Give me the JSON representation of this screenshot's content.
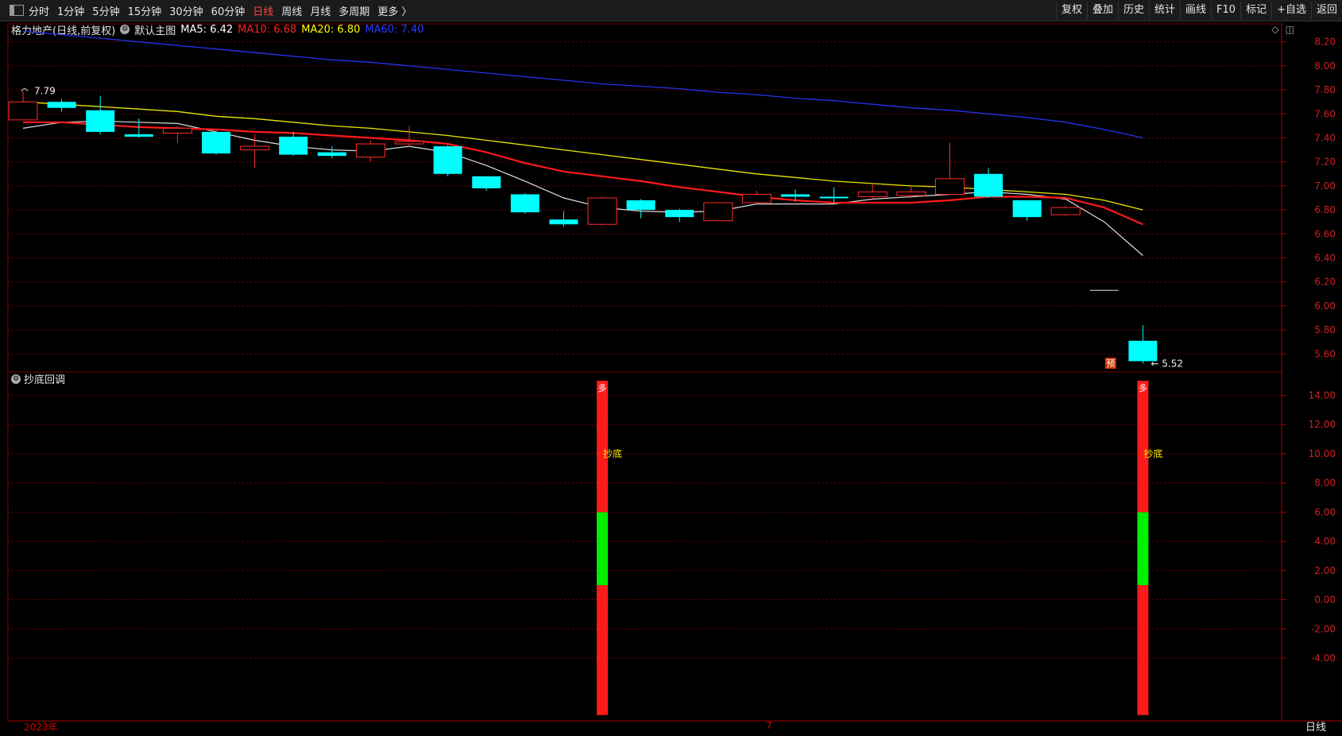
{
  "toolbar": {
    "periods": [
      "分时",
      "1分钟",
      "5分钟",
      "15分钟",
      "30分钟",
      "60分钟",
      "日线",
      "周线",
      "月线",
      "多周期",
      "更多 〉"
    ],
    "active_period": "日线",
    "right_tools": [
      "复权",
      "叠加",
      "历史",
      "统计",
      "画线",
      "F10",
      "标记",
      "+自选",
      "返回"
    ]
  },
  "main_panel": {
    "stock_title": "格力地产(日线,前复权)",
    "template": "默认主图",
    "ma": [
      {
        "label": "MA5: 6.42",
        "color": "#ffffff"
      },
      {
        "label": "MA10: 6.68",
        "color": "#ff2020"
      },
      {
        "label": "MA20: 6.80",
        "color": "#ffff00"
      },
      {
        "label": "MA60: 7.40",
        "color": "#2a3cff"
      }
    ],
    "high_label": "7.79",
    "low_label": "5.52",
    "forecast_badge": "预",
    "colors": {
      "up": "#ff2a2a",
      "down": "#00ffff",
      "ma5": "#dddddd",
      "ma10": "#ff1a1a",
      "ma20": "#e8e800",
      "ma60": "#2233ee",
      "grid": "#7a0000"
    }
  },
  "indicator_panel": {
    "title": "抄底回调",
    "signal_top_label": "多",
    "signal_mid_label": "抄底",
    "colors": {
      "red": "#ff1a1a",
      "green": "#00ee00",
      "label": "#ffee00"
    }
  },
  "footer": {
    "year": "2023年",
    "month": "7",
    "tab": "日线"
  },
  "chart_data": [
    {
      "type": "candlestick",
      "title": "格力地产(日线,前复权)",
      "ylim": [
        5.45,
        8.35
      ],
      "y_ticks": [
        8.2,
        8.0,
        7.8,
        7.6,
        7.4,
        7.2,
        7.0,
        6.8,
        6.6,
        6.4,
        6.2,
        6.0,
        5.8,
        5.6
      ],
      "candles": [
        {
          "o": 7.55,
          "c": 7.7,
          "h": 7.79,
          "l": 7.55
        },
        {
          "o": 7.7,
          "c": 7.65,
          "h": 7.72,
          "l": 7.62
        },
        {
          "o": 7.63,
          "c": 7.45,
          "h": 7.75,
          "l": 7.43
        },
        {
          "o": 7.43,
          "c": 7.41,
          "h": 7.56,
          "l": 7.4
        },
        {
          "o": 7.44,
          "c": 7.48,
          "h": 7.5,
          "l": 7.36
        },
        {
          "o": 7.45,
          "c": 7.27,
          "h": 7.46,
          "l": 7.26
        },
        {
          "o": 7.3,
          "c": 7.33,
          "h": 7.43,
          "l": 7.15
        },
        {
          "o": 7.41,
          "c": 7.26,
          "h": 7.45,
          "l": 7.25
        },
        {
          "o": 7.28,
          "c": 7.25,
          "h": 7.33,
          "l": 7.23
        },
        {
          "o": 7.24,
          "c": 7.35,
          "h": 7.38,
          "l": 7.2
        },
        {
          "o": 7.35,
          "c": 7.37,
          "h": 7.5,
          "l": 7.32
        },
        {
          "o": 7.33,
          "c": 7.1,
          "h": 7.34,
          "l": 7.08
        },
        {
          "o": 7.08,
          "c": 6.98,
          "h": 7.08,
          "l": 6.96
        },
        {
          "o": 6.93,
          "c": 6.78,
          "h": 6.94,
          "l": 6.77
        },
        {
          "o": 6.72,
          "c": 6.68,
          "h": 6.79,
          "l": 6.66
        },
        {
          "o": 6.68,
          "c": 6.9,
          "h": 6.91,
          "l": 6.67
        },
        {
          "o": 6.88,
          "c": 6.8,
          "h": 6.89,
          "l": 6.73
        },
        {
          "o": 6.8,
          "c": 6.74,
          "h": 6.81,
          "l": 6.7
        },
        {
          "o": 6.71,
          "c": 6.86,
          "h": 6.86,
          "l": 6.71
        },
        {
          "o": 6.86,
          "c": 6.93,
          "h": 6.96,
          "l": 6.85
        },
        {
          "o": 6.93,
          "c": 6.91,
          "h": 6.97,
          "l": 6.87
        },
        {
          "o": 6.91,
          "c": 6.9,
          "h": 6.99,
          "l": 6.86
        },
        {
          "o": 6.91,
          "c": 6.95,
          "h": 7.02,
          "l": 6.88
        },
        {
          "o": 6.92,
          "c": 6.95,
          "h": 7.0,
          "l": 6.9
        },
        {
          "o": 6.93,
          "c": 7.06,
          "h": 7.36,
          "l": 6.92
        },
        {
          "o": 7.1,
          "c": 6.91,
          "h": 7.15,
          "l": 6.9
        },
        {
          "o": 6.88,
          "c": 6.74,
          "h": 6.88,
          "l": 6.71
        },
        {
          "o": 6.76,
          "c": 6.82,
          "h": 6.83,
          "l": 6.75
        },
        {
          "o": 6.13,
          "c": 6.13,
          "h": 6.13,
          "l": 6.13,
          "flat": true
        },
        {
          "o": 5.71,
          "c": 5.54,
          "h": 5.84,
          "l": 5.52
        }
      ],
      "series": [
        {
          "name": "MA5",
          "values": [
            7.48,
            7.53,
            7.54,
            7.53,
            7.52,
            7.45,
            7.38,
            7.33,
            7.3,
            7.29,
            7.33,
            7.28,
            7.17,
            7.04,
            6.9,
            6.82,
            6.79,
            6.78,
            6.79,
            6.85,
            6.85,
            6.85,
            6.89,
            6.91,
            6.93,
            6.95,
            6.93,
            6.89,
            6.7,
            6.42
          ]
        },
        {
          "name": "MA10",
          "values": [
            7.53,
            7.53,
            7.51,
            7.49,
            7.48,
            7.47,
            7.45,
            7.44,
            7.42,
            7.4,
            7.38,
            7.35,
            7.28,
            7.19,
            7.12,
            7.08,
            7.04,
            6.99,
            6.95,
            6.91,
            6.88,
            6.86,
            6.86,
            6.86,
            6.88,
            6.91,
            6.91,
            6.9,
            6.82,
            6.68
          ]
        },
        {
          "name": "MA20",
          "values": [
            7.7,
            7.68,
            7.66,
            7.64,
            7.62,
            7.58,
            7.56,
            7.53,
            7.5,
            7.48,
            7.45,
            7.42,
            7.38,
            7.34,
            7.3,
            7.26,
            7.22,
            7.18,
            7.14,
            7.1,
            7.07,
            7.04,
            7.02,
            7.0,
            6.99,
            6.97,
            6.95,
            6.93,
            6.88,
            6.8
          ]
        },
        {
          "name": "MA60",
          "values": [
            8.29,
            8.26,
            8.23,
            8.2,
            8.17,
            8.14,
            8.11,
            8.08,
            8.05,
            8.03,
            8.0,
            7.97,
            7.94,
            7.91,
            7.88,
            7.85,
            7.83,
            7.81,
            7.78,
            7.76,
            7.73,
            7.71,
            7.68,
            7.65,
            7.63,
            7.6,
            7.57,
            7.53,
            7.47,
            7.4
          ]
        }
      ]
    },
    {
      "type": "bar",
      "title": "抄底回调",
      "ylim": [
        -8.3,
        15.6
      ],
      "y_ticks": [
        14.0,
        12.0,
        10.0,
        8.0,
        6.0,
        4.0,
        2.0,
        0.0,
        -2.0,
        -4.0
      ],
      "signal_indices": [
        15,
        29
      ],
      "segments": [
        {
          "from": -7.9,
          "to": 1.0,
          "color": "red"
        },
        {
          "from": 1.0,
          "to": 6.0,
          "color": "green"
        },
        {
          "from": 6.0,
          "to": 15.0,
          "color": "red"
        }
      ]
    }
  ]
}
